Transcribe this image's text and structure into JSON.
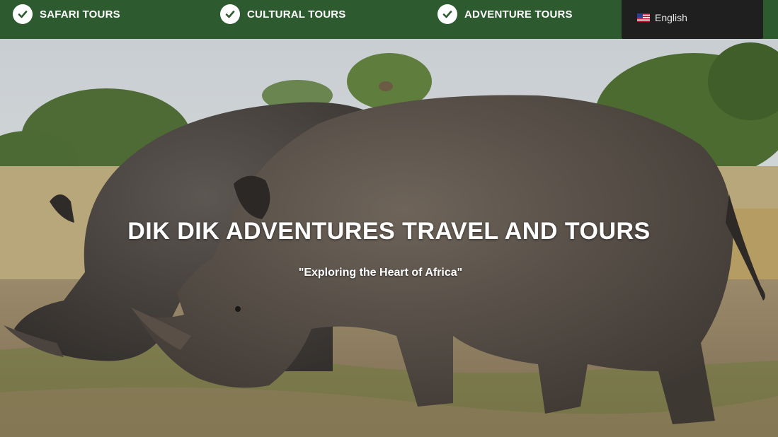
{
  "nav": {
    "items": [
      {
        "label": "SAFARI TOURS",
        "icon": "check-circle-icon"
      },
      {
        "label": "CULTURAL TOURS",
        "icon": "check-circle-icon"
      },
      {
        "label": "ADVENTURE TOURS",
        "icon": "check-circle-icon"
      }
    ],
    "language": {
      "label": "English",
      "icon": "us-flag-icon"
    }
  },
  "hero": {
    "title": "DIK DIK ADVENTURES TRAVEL AND TOURS",
    "subtitle": "\"Exploring the Heart of Africa\"",
    "image": "two-rhinos-grazing-photo"
  },
  "colors": {
    "topbar": "#2d5a2e",
    "language_box": "#1f1f1f",
    "text": "#ffffff"
  }
}
